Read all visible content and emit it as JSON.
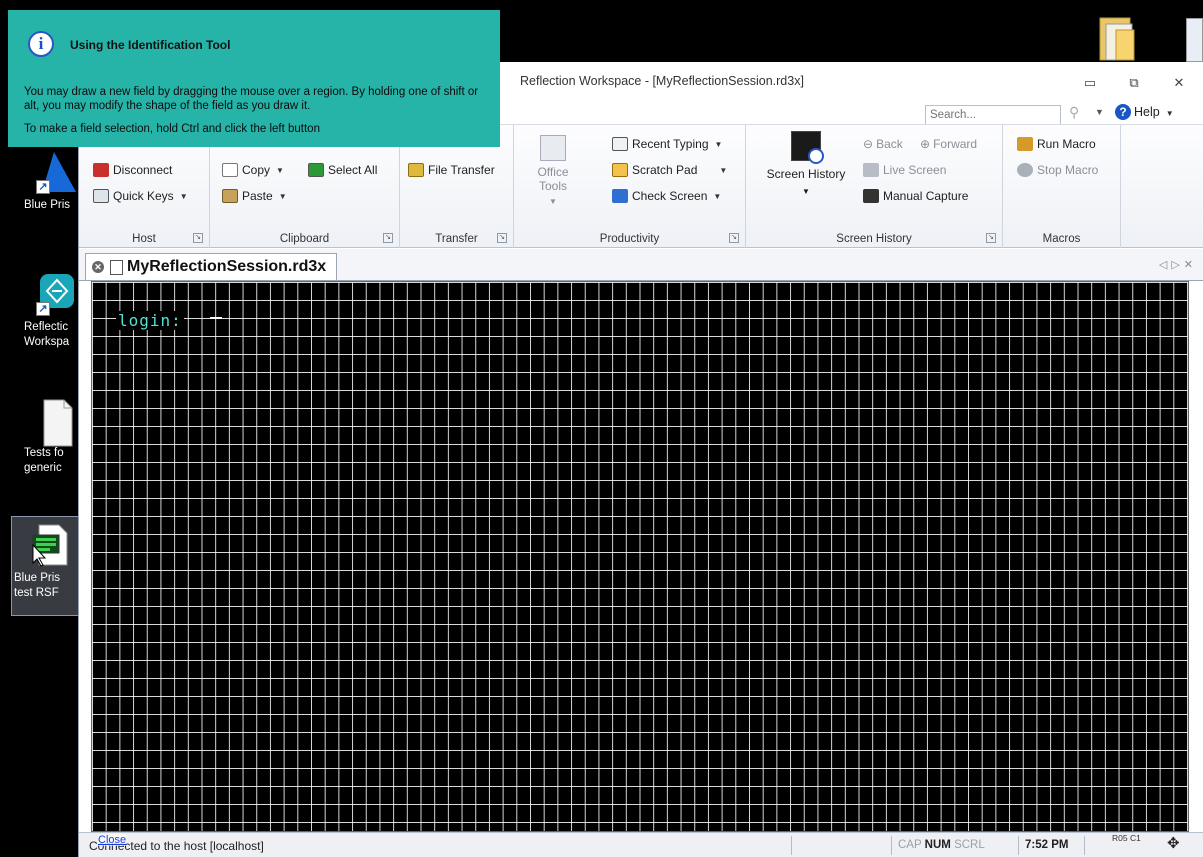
{
  "tooltip": {
    "title": "Using the Identification Tool",
    "body": "You may draw a new field by dragging the mouse over a region. By holding one of shift or alt, you may modify the shape of the field as you draw it.",
    "hint": "To make a field selection, hold Ctrl and click the left button"
  },
  "desktop": {
    "icons": [
      {
        "label1": "Blue Pris",
        "label2": ""
      },
      {
        "label1": "Reflectic",
        "label2": "Workspa"
      },
      {
        "label1": "Tests fo",
        "label2": "generic"
      },
      {
        "label1": "Blue Pris",
        "label2": "test RSF"
      }
    ]
  },
  "window": {
    "title": "Reflection Workspace - [MyReflectionSession.rd3x]",
    "search_placeholder": "Search...",
    "help_label": "Help"
  },
  "ribbon": {
    "host": {
      "label": "Host",
      "disconnect": "Disconnect",
      "quick_keys": "Quick Keys"
    },
    "clipboard": {
      "label": "Clipboard",
      "copy": "Copy",
      "select_all": "Select All",
      "paste": "Paste"
    },
    "transfer": {
      "label": "Transfer",
      "file_transfer": "File Transfer"
    },
    "productivity": {
      "label": "Productivity",
      "office_tools": "Office Tools",
      "recent_typing": "Recent Typing",
      "scratch_pad": "Scratch Pad",
      "check_screen": "Check Screen"
    },
    "screen_history": {
      "label": "Screen History",
      "screen_history": "Screen History",
      "back": "Back",
      "forward": "Forward",
      "live_screen": "Live Screen",
      "manual_capture": "Manual Capture"
    },
    "macros": {
      "label": "Macros",
      "run_macro": "Run Macro",
      "stop_macro": "Stop Macro"
    }
  },
  "document_tab": {
    "label": "MyReflectionSession.rd3x"
  },
  "terminal": {
    "prompt": "login:"
  },
  "statusbar": {
    "status": "Connected to the host [localhost]",
    "close_link": "Close",
    "cap": "CAP",
    "num": "NUM",
    "scrl": "SCRL",
    "time": "7:52 PM",
    "rowcol": "R05 C1"
  },
  "colors": {
    "tooltip_bg": "#26b4a9",
    "terminal_text": "#4fe3d8",
    "terminal_bg": "#000000"
  }
}
